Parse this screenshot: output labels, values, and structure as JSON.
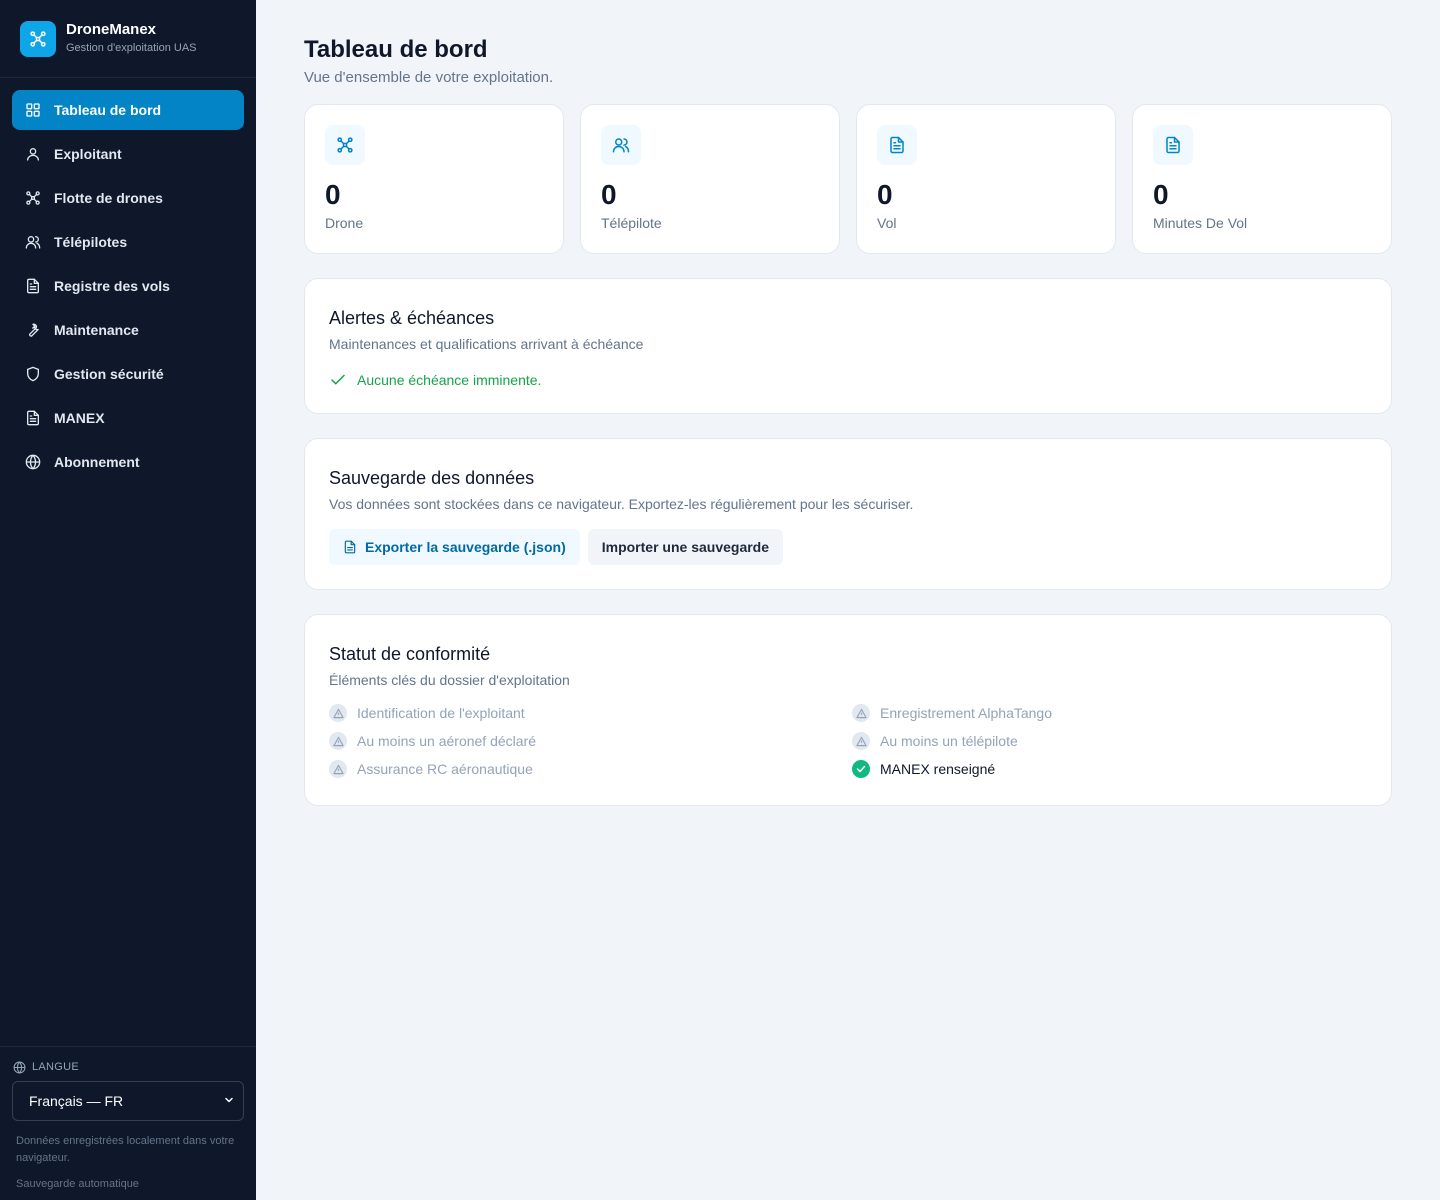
{
  "brand": {
    "name": "DroneManex",
    "subtitle": "Gestion d'exploitation UAS"
  },
  "nav": [
    {
      "label": "Tableau de bord",
      "icon": "grid-icon",
      "active": true
    },
    {
      "label": "Exploitant",
      "icon": "user-icon"
    },
    {
      "label": "Flotte de drones",
      "icon": "drone-icon"
    },
    {
      "label": "Télépilotes",
      "icon": "users-icon"
    },
    {
      "label": "Registre des vols",
      "icon": "document-icon"
    },
    {
      "label": "Maintenance",
      "icon": "wrench-icon"
    },
    {
      "label": "Gestion sécurité",
      "icon": "shield-icon"
    },
    {
      "label": "MANEX",
      "icon": "document-icon"
    },
    {
      "label": "Abonnement",
      "icon": "globe-icon"
    }
  ],
  "sidebar_footer": {
    "language_label": "LANGUE",
    "language_value": "Français — FR",
    "storage_note": "Données enregistrées localement dans votre navigateur.",
    "autosave_note": "Sauvegarde automatique"
  },
  "page": {
    "title": "Tableau de bord",
    "subtitle": "Vue d'ensemble de votre exploitation."
  },
  "stats": [
    {
      "value": "0",
      "label": "Drone",
      "icon": "drone-icon"
    },
    {
      "value": "0",
      "label": "Télépilote",
      "icon": "users-icon"
    },
    {
      "value": "0",
      "label": "Vol",
      "icon": "document-icon"
    },
    {
      "value": "0",
      "label": "Minutes De Vol",
      "icon": "document-icon"
    }
  ],
  "alerts": {
    "title": "Alertes & échéances",
    "description": "Maintenances et qualifications arrivant à échéance",
    "status": "Aucune échéance imminente."
  },
  "backup": {
    "title": "Sauvegarde des données",
    "description": "Vos données sont stockées dans ce navigateur. Exportez-les régulièrement pour les sécuriser.",
    "export_label": "Exporter la sauvegarde (.json)",
    "import_label": "Importer une sauvegarde"
  },
  "compliance": {
    "title": "Statut de conformité",
    "description": "Éléments clés du dossier d'exploitation",
    "items": [
      {
        "label": "Identification de l'exploitant",
        "done": false
      },
      {
        "label": "Enregistrement AlphaTango",
        "done": false
      },
      {
        "label": "Au moins un aéronef déclaré",
        "done": false
      },
      {
        "label": "Au moins un télépilote",
        "done": false
      },
      {
        "label": "Assurance RC aéronautique",
        "done": false
      },
      {
        "label": "MANEX renseigné",
        "done": true
      }
    ]
  },
  "colors": {
    "sidebar": "#0f172a",
    "accent": "#0284c7",
    "success": "#10b981",
    "background": "#f1f5f9"
  }
}
